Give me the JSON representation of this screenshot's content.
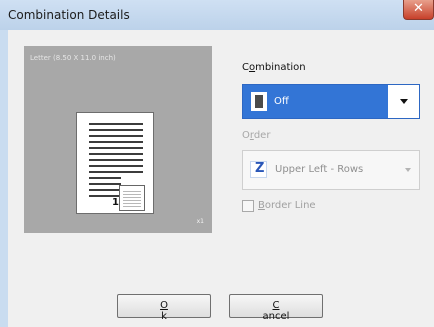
{
  "window": {
    "title": "Combination Details",
    "close_symbol": "✕"
  },
  "preview": {
    "paper_label": "Letter (8.50 X 11.0 inch)",
    "page_number": "1",
    "copies": "x1"
  },
  "combination": {
    "label": "Combination",
    "selected": "Off"
  },
  "order": {
    "label": "Order",
    "selected": "Upper Left - Rows",
    "icon_symbol": "Z"
  },
  "border_line": {
    "label": "Border Line",
    "checked": false
  },
  "buttons": {
    "ok": "Ok",
    "cancel": "Cancel"
  }
}
